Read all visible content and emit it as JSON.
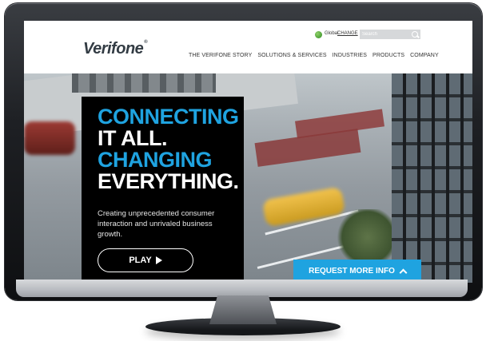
{
  "header": {
    "logo": "Verifone",
    "logo_mark": "®",
    "region_label": "Global",
    "change_link": "CHANGE",
    "search_placeholder": "Search"
  },
  "nav": {
    "items": [
      {
        "label": "THE VERIFONE STORY"
      },
      {
        "label": "SOLUTIONS & SERVICES"
      },
      {
        "label": "INDUSTRIES"
      },
      {
        "label": "PRODUCTS"
      },
      {
        "label": "COMPANY"
      }
    ]
  },
  "hero": {
    "headline": [
      {
        "text": "CONNECTING",
        "color": "#1fa3e0"
      },
      {
        "text": "IT ALL.",
        "color": "#ffffff"
      },
      {
        "text": "CHANGING",
        "color": "#1fa3e0"
      },
      {
        "text": "EVERYTHING.",
        "color": "#ffffff"
      }
    ],
    "subcopy": "Creating unprecedented consumer interaction and unrivaled business growth.",
    "play_label": "PLAY",
    "request_label": "REQUEST MORE INFO"
  },
  "colors": {
    "accent": "#1fa3e0",
    "panel": "#000000",
    "search_bg": "#d6d8da"
  },
  "icons": [
    "globe-icon",
    "search-icon",
    "play-icon",
    "chevron-up-icon"
  ]
}
